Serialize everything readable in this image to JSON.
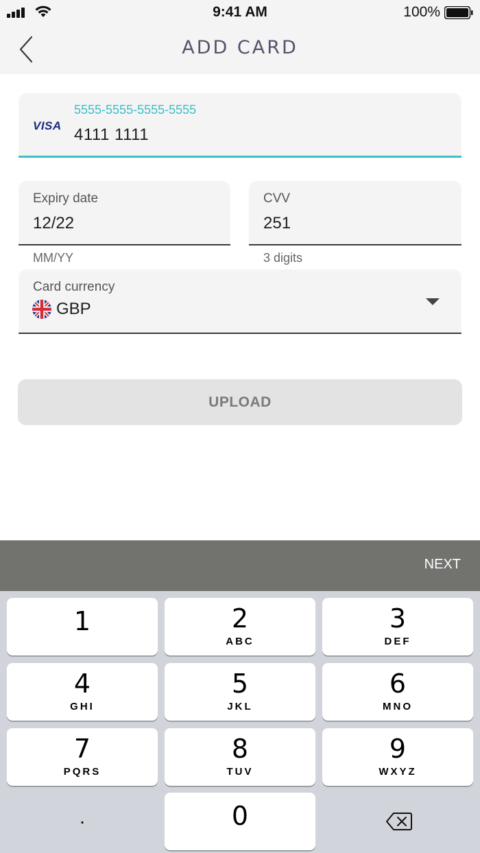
{
  "status_bar": {
    "time": "9:41 AM",
    "battery_percent": "100%",
    "icons": [
      "signal-icon",
      "wifi-icon",
      "battery-icon"
    ]
  },
  "nav": {
    "title": "ADD CARD",
    "back_icon": "chevron-left-icon"
  },
  "card_number": {
    "brand": "VISA",
    "hint": "5555-5555-5555-5555",
    "value": "4111 1111"
  },
  "expiry": {
    "label": "Expiry date",
    "value": "12/22",
    "helper": "MM/YY"
  },
  "cvv": {
    "label": "CVV",
    "value": "251",
    "helper": "3 digits"
  },
  "currency": {
    "label": "Card currency",
    "value": "GBP",
    "flag_icon": "uk-flag-icon",
    "dropdown_icon": "caret-down-icon"
  },
  "upload_button": "UPLOAD",
  "keyboard": {
    "next_label": "NEXT",
    "keys": [
      {
        "digit": "1",
        "letters": ""
      },
      {
        "digit": "2",
        "letters": "ABC"
      },
      {
        "digit": "3",
        "letters": "DEF"
      },
      {
        "digit": "4",
        "letters": "GHI"
      },
      {
        "digit": "5",
        "letters": "JKL"
      },
      {
        "digit": "6",
        "letters": "MNO"
      },
      {
        "digit": "7",
        "letters": "PQRS"
      },
      {
        "digit": "8",
        "letters": "TUV"
      },
      {
        "digit": "9",
        "letters": "WXYZ"
      },
      {
        "digit": "0",
        "letters": ""
      }
    ],
    "dot_label": ".",
    "delete_icon": "backspace-icon"
  },
  "colors": {
    "accent": "#3cbfc6",
    "title": "#55526b",
    "field_bg": "#f4f4f4",
    "keyboard_bg": "#d1d4da",
    "accessory_bg": "#72736f"
  }
}
